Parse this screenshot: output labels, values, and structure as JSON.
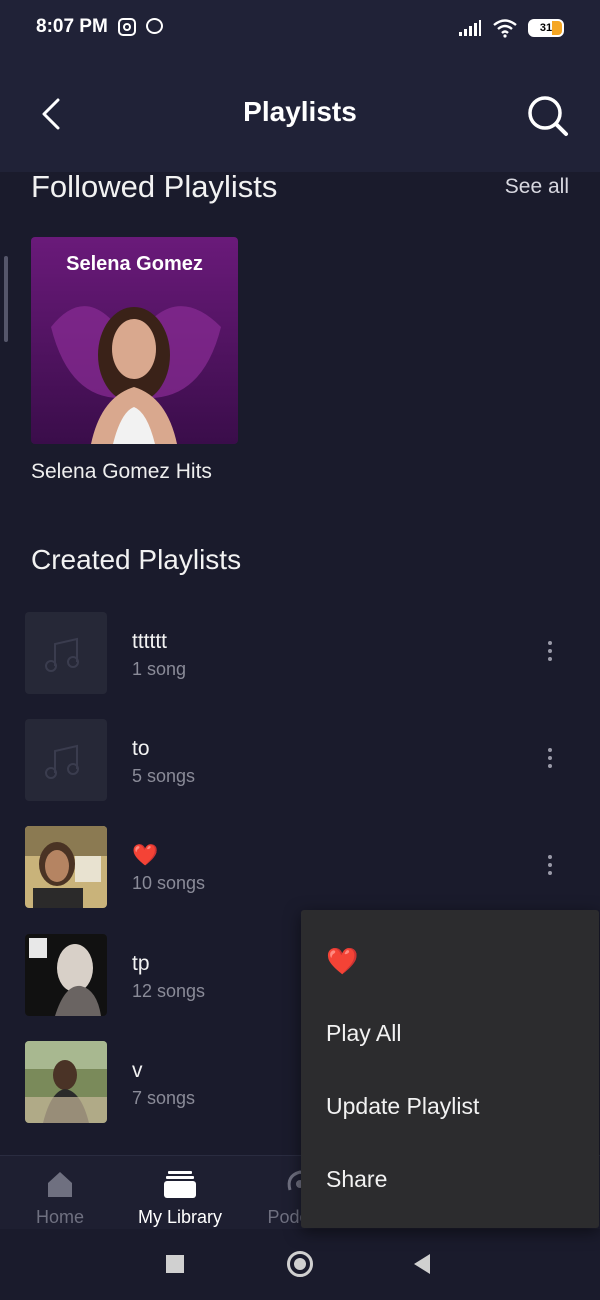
{
  "status_bar": {
    "time": "8:07 PM",
    "battery": "31"
  },
  "header": {
    "title": "Playlists"
  },
  "followed": {
    "heading": "Followed Playlists",
    "see_all": "See all",
    "items": [
      {
        "cover_text": "Selena Gomez",
        "name": "Selena Gomez Hits"
      }
    ]
  },
  "created": {
    "heading": "Created Playlists",
    "items": [
      {
        "name": "tttttt",
        "count": "1 song"
      },
      {
        "name": "to",
        "count": "5 songs"
      },
      {
        "name": "❤️",
        "count": "10 songs"
      },
      {
        "name": "tp",
        "count": "12 songs"
      },
      {
        "name": "v",
        "count": "7 songs"
      }
    ]
  },
  "bottom_nav": {
    "items": [
      {
        "label": "Home"
      },
      {
        "label": "My Library"
      },
      {
        "label": "Podc"
      }
    ]
  },
  "context_menu": {
    "items": [
      {
        "label": "❤️"
      },
      {
        "label": "Play All"
      },
      {
        "label": "Update Playlist"
      },
      {
        "label": "Share"
      }
    ]
  }
}
